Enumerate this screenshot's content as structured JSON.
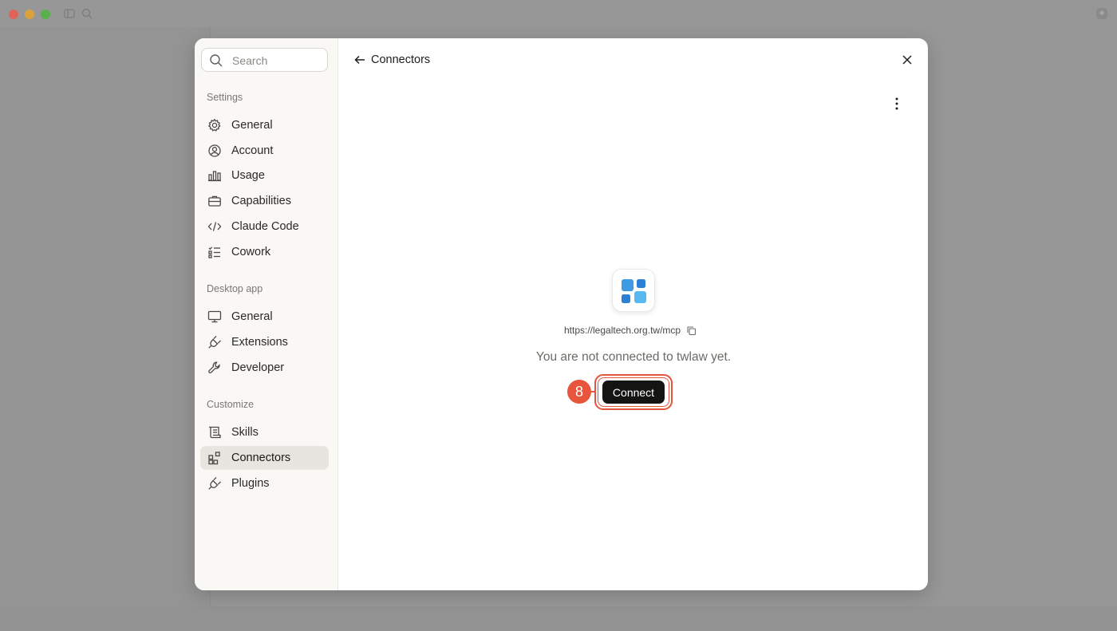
{
  "window": {
    "traffic_lights": [
      "close",
      "minimize",
      "zoom"
    ],
    "toolbar_icons": [
      "sidebar-toggle-icon",
      "search-icon"
    ]
  },
  "sidebar": {
    "search_placeholder": "Search",
    "sections": [
      {
        "heading": "Settings",
        "items": [
          {
            "label": "General",
            "icon": "gear-icon"
          },
          {
            "label": "Account",
            "icon": "account-icon"
          },
          {
            "label": "Usage",
            "icon": "bar-chart-icon"
          },
          {
            "label": "Capabilities",
            "icon": "briefcase-icon"
          },
          {
            "label": "Claude Code",
            "icon": "code-icon"
          },
          {
            "label": "Cowork",
            "icon": "checklist-icon"
          }
        ]
      },
      {
        "heading": "Desktop app",
        "items": [
          {
            "label": "General",
            "icon": "monitor-icon"
          },
          {
            "label": "Extensions",
            "icon": "plug-icon"
          },
          {
            "label": "Developer",
            "icon": "wrench-icon"
          }
        ]
      },
      {
        "heading": "Customize",
        "items": [
          {
            "label": "Skills",
            "icon": "scroll-icon"
          },
          {
            "label": "Connectors",
            "icon": "connectors-icon",
            "active": true
          },
          {
            "label": "Plugins",
            "icon": "plug-icon"
          }
        ]
      }
    ]
  },
  "main": {
    "title": "Connectors",
    "connector_url": "https://legaltech.org.tw/mcp",
    "status_message": "You are not connected to twlaw yet.",
    "connect_label": "Connect",
    "step_number": "8"
  },
  "colors": {
    "accent_annotation": "#e2563e",
    "primary_button": "#141413",
    "tile_blue_dark": "#2b7fd4",
    "tile_blue_light": "#5ab8f0"
  }
}
